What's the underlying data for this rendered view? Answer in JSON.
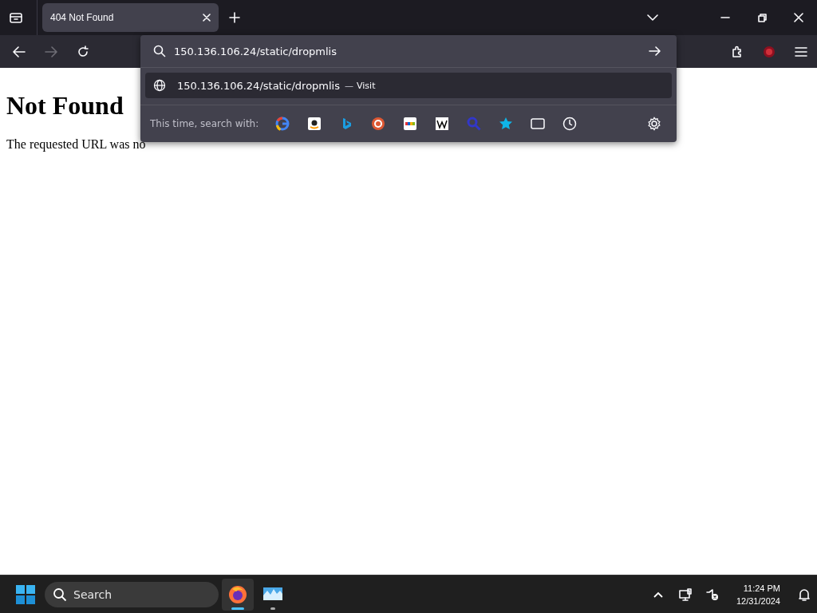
{
  "tabs": [
    {
      "title": "404 Not Found",
      "selected": true
    }
  ],
  "nav": {
    "back_disabled": false,
    "forward_disabled": true
  },
  "urlbar": {
    "value": "150.136.106.24/static/dropmlis"
  },
  "suggestions": [
    {
      "url": "150.136.106.24/static/dropmlis",
      "separator": "—",
      "action": "Visit",
      "selected": true
    }
  ],
  "search_with": {
    "label": "This time, search with:"
  },
  "page": {
    "heading": "Not Found",
    "text": "The requested URL was no"
  },
  "taskbar": {
    "search_placeholder": "Search",
    "apps": [
      {
        "kind": "browser",
        "selected": true
      },
      {
        "kind": "monitor",
        "selected": false
      }
    ],
    "time": "11:24 PM",
    "date": "12/31/2024"
  }
}
